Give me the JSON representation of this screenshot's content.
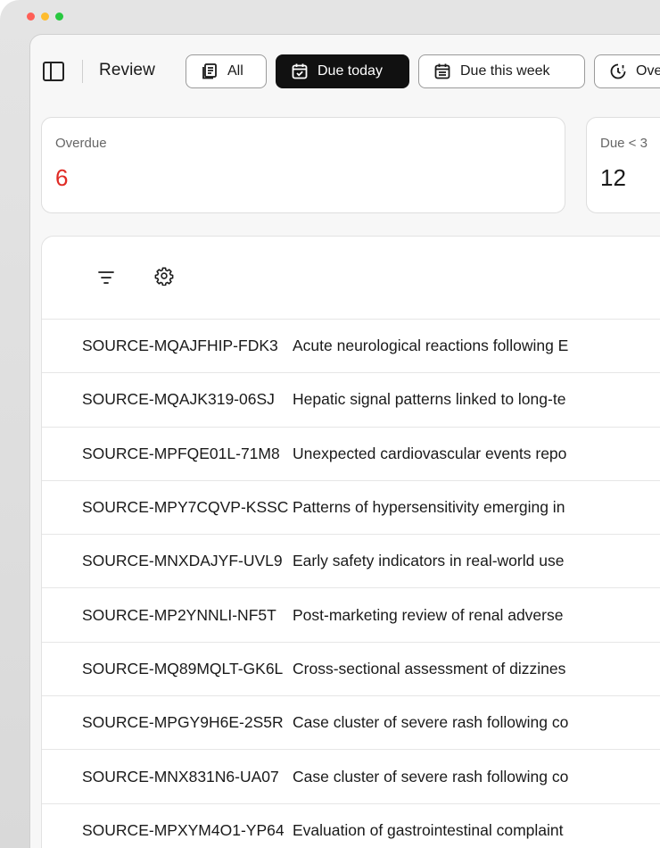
{
  "window": {
    "colors": {
      "close": "#ff5f57",
      "minimize": "#febc2e",
      "zoom": "#28c840"
    }
  },
  "toolbar": {
    "title": "Review",
    "tabs": [
      {
        "label": "All",
        "icon": "stack-icon",
        "active": false
      },
      {
        "label": "Due today",
        "icon": "calendar-check-icon",
        "active": true
      },
      {
        "label": "Due this week",
        "icon": "calendar-week-icon",
        "active": false
      },
      {
        "label": "Ove",
        "icon": "clock-alert-icon",
        "active": false
      }
    ]
  },
  "stats": [
    {
      "label": "Overdue",
      "value": "6",
      "color": "#e02b25"
    },
    {
      "label": "Due < 3",
      "value": "12",
      "color": "#1a1a1a"
    }
  ],
  "table": {
    "tools": [
      "filter-icon",
      "gear-icon"
    ],
    "rows": [
      {
        "id": "SOURCE-MQAJFHIP-FDK3",
        "title": "Acute neurological reactions following E"
      },
      {
        "id": "SOURCE-MQAJK319-06SJ",
        "title": "Hepatic signal patterns linked to long-te"
      },
      {
        "id": "SOURCE-MPFQE01L-71M8",
        "title": "Unexpected cardiovascular events repo"
      },
      {
        "id": "SOURCE-MPY7CQVP-KSSC",
        "title": "Patterns of hypersensitivity emerging in"
      },
      {
        "id": "SOURCE-MNXDAJYF-UVL9",
        "title": "Early safety indicators in real-world use"
      },
      {
        "id": "SOURCE-MP2YNNLI-NF5T",
        "title": "Post-marketing review of renal adverse"
      },
      {
        "id": "SOURCE-MQ89MQLT-GK6L",
        "title": "Cross-sectional assessment of dizzines"
      },
      {
        "id": "SOURCE-MPGY9H6E-2S5R",
        "title": "Case cluster of severe rash following co"
      },
      {
        "id": "SOURCE-MNX831N6-UA07",
        "title": "Case cluster of severe rash following co"
      },
      {
        "id": "SOURCE-MPXYM4O1-YP64",
        "title": "Evaluation of gastrointestinal complaint"
      }
    ]
  }
}
